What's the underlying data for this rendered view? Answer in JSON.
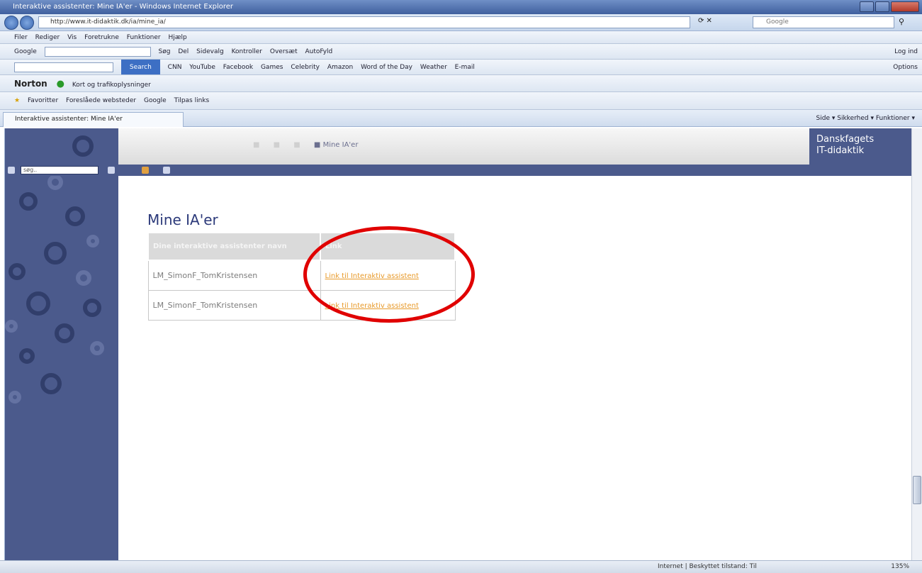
{
  "browser": {
    "title": "Interaktive assistenter: Mine IA'er - Windows Internet Explorer",
    "url": "http://www.it-didaktik.dk/ia/mine_ia/",
    "search_placeholder": "Google",
    "menu": [
      "Filer",
      "Rediger",
      "Vis",
      "Foretrukne",
      "Funktioner",
      "Hjælp"
    ],
    "google_toolbar": {
      "label": "Google",
      "items": [
        "Søg",
        "Del",
        "Sidevalg",
        "Kontroller",
        "Oversæt",
        "AutoFyld"
      ],
      "signin": "Log ind"
    },
    "links_toolbar": {
      "search_button": "Search",
      "items": [
        "CNN",
        "YouTube",
        "Facebook",
        "Games",
        "Celebrity",
        "Amazon",
        "Word of the Day",
        "Weather",
        "E-mail"
      ],
      "options": "Options"
    },
    "norton_toolbar": {
      "label": "Norton",
      "items": [
        "Kort og trafikoplysninger"
      ]
    },
    "favorites_bar": {
      "favorites_label": "Favoritter",
      "items": [
        "Foreslåede websteder",
        "Google",
        "Tilpas links"
      ]
    },
    "tab_label": "Interaktive assistenter: Mine IA'er",
    "command_bar": "Side ▾  Sikkerhed ▾  Funktioner ▾",
    "status_zone": "Internet | Beskyttet tilstand: Til",
    "zoom": "135%"
  },
  "site": {
    "brand_line1": "Danskfagets",
    "brand_line2": "IT-didaktik",
    "breadcrumb_current": "Mine IA'er",
    "search_value": "søg..",
    "page_title": "Mine IA'er",
    "table": {
      "headers": [
        "Dine interaktive assistenter navn",
        "Link"
      ],
      "rows": [
        {
          "name": "LM_SimonF_TomKristensen",
          "link": "Link til Interaktiv assistent"
        },
        {
          "name": "LM_SimonF_TomKristensen",
          "link": "Link til Interaktiv assistent"
        }
      ]
    }
  },
  "colors": {
    "accent": "#4b5a8c",
    "link": "#e89a2a",
    "highlight_circle": "#e00000"
  }
}
